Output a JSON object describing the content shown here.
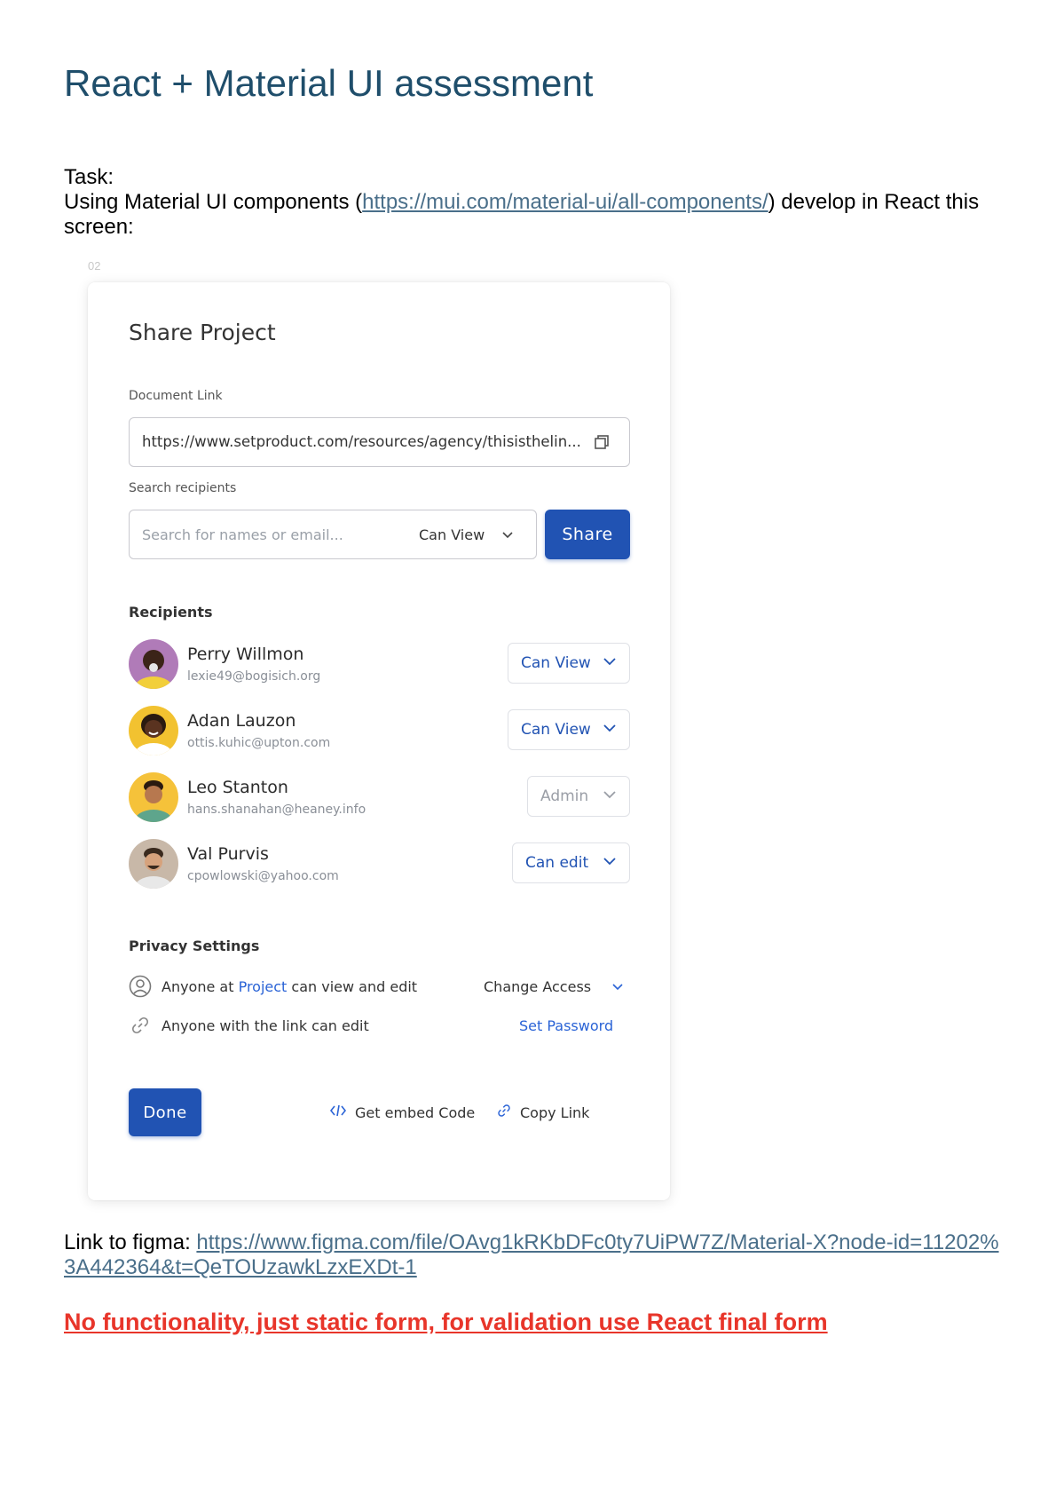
{
  "document": {
    "title": "React + Material UI assessment",
    "task_label": "Task:",
    "task_text_before": "Using Material UI components (",
    "task_link": "https://mui.com/material-ui/all-components/",
    "task_text_after": ") develop in React this screen:",
    "frame_label": "02",
    "figma_label": "Link to figma: ",
    "figma_link": "https://www.figma.com/file/OAvg1kRKbDFc0ty7UiPW7Z/Material-X?node-id=11202%3A442364&t=QeTOUzawkLzxEXDt-1",
    "warning": "No functionality, just static form, for validation use  React final form"
  },
  "dialog": {
    "title": "Share Project",
    "document_link_label": "Document Link",
    "document_link_value": "https://www.setproduct.com/resources/agency/thisisthelin...",
    "search_label": "Search recipients",
    "search_placeholder": "Search for names or email...",
    "search_permission": "Can View",
    "share_button": "Share",
    "recipients_title": "Recipients",
    "recipients": [
      {
        "name": "Perry Willmon",
        "email": "lexie49@bogisich.org",
        "role": "Can View",
        "disabled": false,
        "avatar_bg": "#b07bb8",
        "skin": "#3b2418",
        "shirt": "#f2cf3a"
      },
      {
        "name": "Adan Lauzon",
        "email": "ottis.kuhic@upton.com",
        "role": "Can View",
        "disabled": false,
        "avatar_bg": "#f2c230",
        "skin": "#5a3320",
        "shirt": "#ffffff"
      },
      {
        "name": "Leo Stanton",
        "email": "hans.shanahan@heaney.info",
        "role": "Admin",
        "disabled": true,
        "avatar_bg": "#f5c23a",
        "skin": "#b7784f",
        "shirt": "#5ea58c"
      },
      {
        "name": "Val Purvis",
        "email": "cpowlowski@yahoo.com",
        "role": "Can edit",
        "disabled": false,
        "avatar_bg": "#c8b8a8",
        "skin": "#d6a27c",
        "shirt": "#e8e8e8"
      }
    ],
    "privacy_title": "Privacy Settings",
    "privacy_1_prefix": "Anyone at ",
    "privacy_1_project": "Project",
    "privacy_1_suffix": " can view and edit",
    "change_access": "Change Access",
    "privacy_2": "Anyone with the link can edit",
    "set_password": "Set Password",
    "done_button": "Done",
    "embed_code": "Get embed Code",
    "copy_link": "Copy Link"
  },
  "colors": {
    "primary": "#2153b3",
    "link_blue": "#2a63d6",
    "title": "#1f4e6b",
    "warning": "#e8352a"
  }
}
